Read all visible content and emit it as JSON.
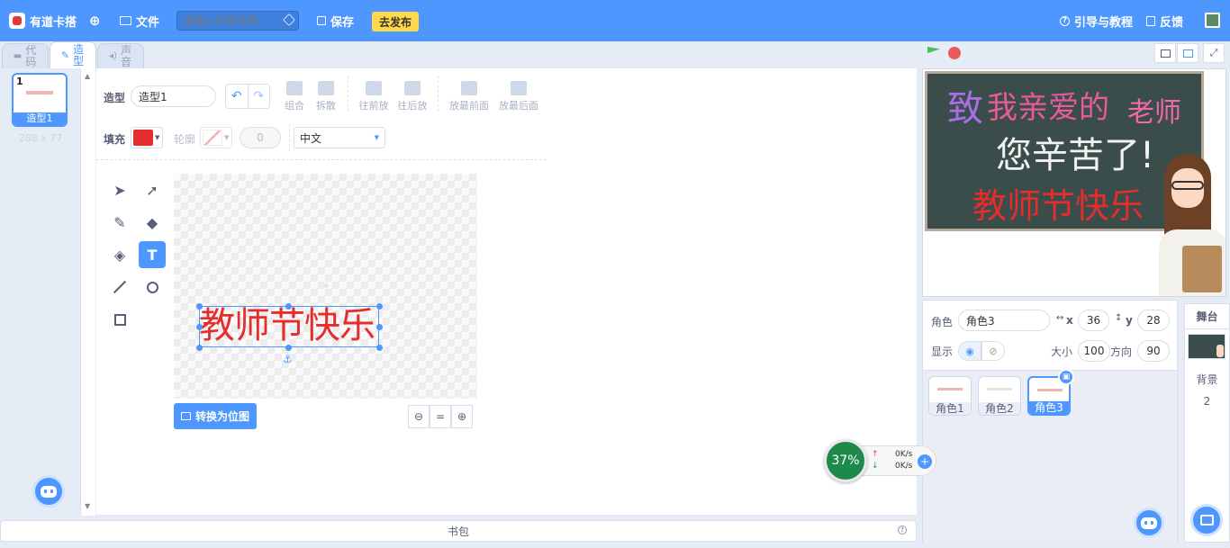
{
  "topbar": {
    "brand": "有道卡搭",
    "file_menu": "文件",
    "project_name_placeholder": "请输入作品名称",
    "save": "保存",
    "publish": "去发布",
    "guide": "引导与教程",
    "feedback": "反馈"
  },
  "tabs": {
    "code": "代码",
    "costume": "造型",
    "sound": "声音"
  },
  "costume_list": {
    "items": [
      {
        "num": "1",
        "name": "造型1",
        "size": "288 x 77"
      }
    ]
  },
  "paint": {
    "costume_label": "造型",
    "costume_name": "造型1",
    "group": "组合",
    "ungroup": "拆散",
    "forward": "往前放",
    "backward": "往后放",
    "front": "放最前面",
    "back": "放最后面",
    "fill_label": "填充",
    "outline_label": "轮廓",
    "outline_width": "0",
    "font": "中文",
    "canvas_text": "教师节快乐",
    "convert_bitmap": "转换为位图",
    "zoom_out": "⊖",
    "zoom_reset": "=",
    "zoom_in": "⊕",
    "fill_color": "#e52d2d"
  },
  "backpack": {
    "label": "书包"
  },
  "stage": {
    "line1_a": "致",
    "line1_b": "我亲爱的",
    "line1_c": "老师",
    "line2": "您辛苦了!",
    "line3": "教师节快乐"
  },
  "sprite_info": {
    "sprite_label": "角色",
    "sprite_name": "角色3",
    "x_label": "x",
    "x": "36",
    "y_label": "y",
    "y": "28",
    "show_label": "显示",
    "size_label": "大小",
    "size": "100",
    "direction_label": "方向",
    "direction": "90"
  },
  "sprites": [
    {
      "name": "角色1"
    },
    {
      "name": "角色2"
    },
    {
      "name": "角色3"
    }
  ],
  "backdrop": {
    "title": "舞台",
    "label": "背景",
    "count": "2"
  },
  "net_widget": {
    "percent": "37%",
    "up": "0K/s",
    "down": "0K/s"
  },
  "colors": {
    "accent": "#4d97ff",
    "publish": "#ffd94a",
    "text_red": "#e52d2d"
  }
}
